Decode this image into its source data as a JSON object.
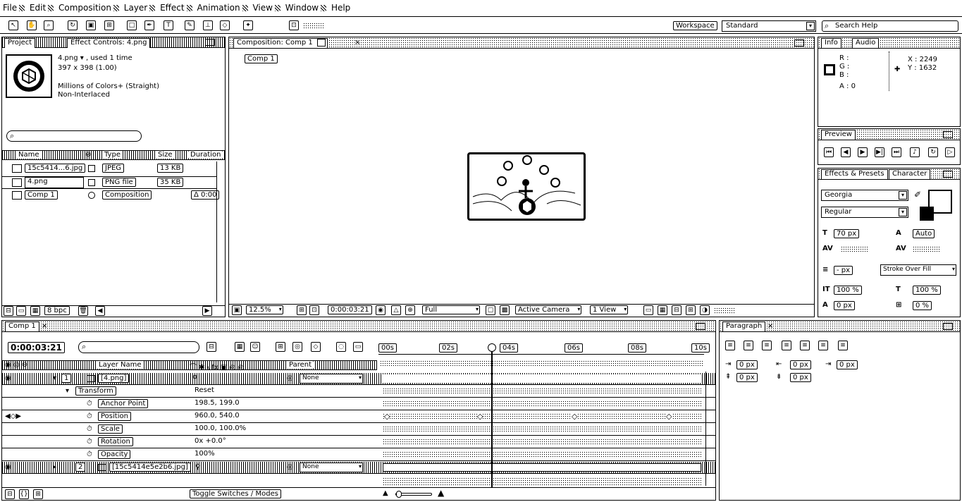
{
  "menubar": {
    "items": [
      "File",
      "Edit",
      "Composition",
      "Layer",
      "Effect",
      "Animation",
      "View",
      "Window",
      "Help"
    ]
  },
  "toolbar": {
    "workspace_label": "Workspace",
    "workspace_value": "Standard",
    "search_placeholder": "Search Help"
  },
  "project_panel": {
    "tab_project": "Project",
    "tab_effect_controls": "Effect Controls: 4.png",
    "file_info_line1": "4.png ▾ , used 1 time",
    "file_info_line2": "397 x 398 (1.00)",
    "file_info_line3": "Millions of Colors+ (Straight)",
    "file_info_line4": "Non-Interlaced",
    "search_value": "",
    "columns": {
      "name": "Name",
      "type": "Type",
      "size": "Size",
      "duration": "Duration"
    },
    "items": [
      {
        "name": "15c5414...6.jpg",
        "type": "JPEG",
        "size": "13 KB",
        "duration": ""
      },
      {
        "name": "4.png",
        "type": "PNG file",
        "size": "35 KB",
        "duration": ""
      },
      {
        "name": "Comp 1",
        "type": "Composition",
        "size": "",
        "duration": "Δ 0:00"
      }
    ],
    "bpc": "8 bpc"
  },
  "composition_panel": {
    "tab": "Composition: Comp 1",
    "crumb": "Comp 1",
    "zoom": "12.5%",
    "timecode": "0:00:03:21",
    "resolution": "Full",
    "camera": "Active Camera",
    "views": "1 View"
  },
  "info_panel": {
    "tab_info": "Info",
    "tab_audio": "Audio",
    "r": "R :",
    "g": "G :",
    "b": "B :",
    "a": "A : 0",
    "x": "X : 2249",
    "y": "Y : 1632"
  },
  "preview_panel": {
    "tab": "Preview"
  },
  "character_panel": {
    "tab_effects": "Effects & Presets",
    "tab_character": "Character",
    "font_family": "Georgia",
    "font_style": "Regular",
    "size": "70 px",
    "leading": "Auto",
    "stroke_width": "- px",
    "stroke_mode": "Stroke Over Fill",
    "scale_v": "100 %",
    "scale_h": "100 %",
    "baseline": "0 px",
    "tsume": "0 %"
  },
  "timeline_panel": {
    "tab": "Comp 1",
    "timecode": "0:00:03:21",
    "search_value": "",
    "col_layer_name": "Layer Name",
    "col_parent": "Parent",
    "ruler": [
      "00s",
      "02s",
      "04s",
      "06s",
      "08s",
      "10s"
    ],
    "layers": [
      {
        "index": "1",
        "name": "[4.png]",
        "parent": "None"
      },
      {
        "index": "2",
        "name": "[15c5414e5e2b6.jpg]",
        "parent": "None"
      }
    ],
    "transform_label": "Transform",
    "transform_reset": "Reset",
    "properties": [
      {
        "name": "Anchor Point",
        "value": "198.5, 199.0"
      },
      {
        "name": "Position",
        "value": "960.0, 540.0"
      },
      {
        "name": "Scale",
        "value": "100.0, 100.0%"
      },
      {
        "name": "Rotation",
        "value": "0x +0.0°"
      },
      {
        "name": "Opacity",
        "value": "100%"
      }
    ],
    "toggle_label": "Toggle Switches / Modes"
  },
  "paragraph_panel": {
    "tab": "Paragraph",
    "indent_left": "0 px",
    "indent_right": "0 px",
    "indent_first": "0 px",
    "space_before": "0 px",
    "space_after": "0 px"
  }
}
